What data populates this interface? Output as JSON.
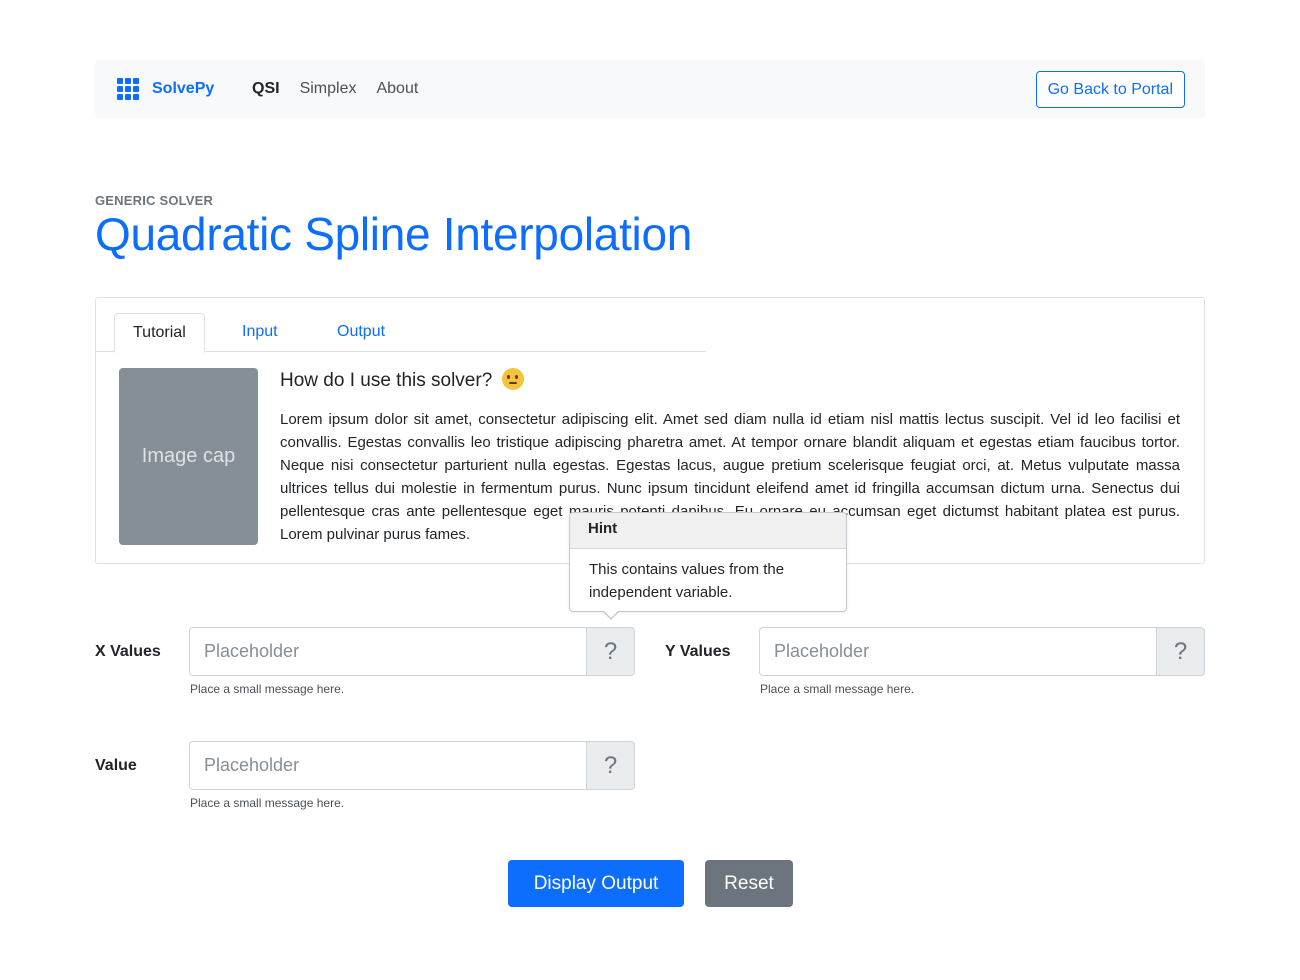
{
  "navbar": {
    "brand": "SolvePy",
    "links": [
      "QSI",
      "Simplex",
      "About"
    ],
    "portal_button": "Go Back to Portal"
  },
  "header": {
    "eyebrow": "GENERIC SOLVER",
    "title": "Quadratic Spline Interpolation"
  },
  "tabs": [
    "Tutorial",
    "Input",
    "Output"
  ],
  "tutorial": {
    "image_label": "Image cap",
    "title": "How do I use this solver?",
    "title_icon": "thinking-face-emoji",
    "body": "Lorem ipsum dolor sit amet, consectetur adipiscing elit. Amet sed diam nulla id etiam nisl mattis lectus suscipit. Vel id leo facilisi et convallis. Egestas convallis leo tristique adipiscing pharetra amet. At tempor ornare blandit aliquam et egestas etiam faucibus tortor. Neque nisi consectetur parturient nulla egestas. Egestas lacus, augue pretium scelerisque feugiat orci, at. Metus vulputate massa ultrices tellus dui molestie in fermentum purus. Nunc ipsum tincidunt eleifend amet id fringilla accumsan dictum urna. Senectus dui pellentesque cras ante pellentesque eget mauris potenti dapibus. Eu ornare eu accumsan eget dictumst habitant platea est purus. Lorem pulvinar purus fames."
  },
  "popover": {
    "header": "Hint",
    "body": "This contains values from the independent variable."
  },
  "form": {
    "x_values": {
      "label": "X Values",
      "placeholder": "Placeholder",
      "help": "?",
      "message": "Place a small message here."
    },
    "y_values": {
      "label": "Y Values",
      "placeholder": "Placeholder",
      "help": "?",
      "message": "Place a small message here."
    },
    "value": {
      "label": "Value",
      "placeholder": "Placeholder",
      "help": "?",
      "message": "Place a small message here."
    }
  },
  "actions": {
    "display_output": "Display Output",
    "reset": "Reset"
  },
  "colors": {
    "primary": "#0d6efd",
    "secondary": "#6c757d",
    "navbar_bg": "#f8f9fa",
    "image_placeholder": "#868e96"
  }
}
